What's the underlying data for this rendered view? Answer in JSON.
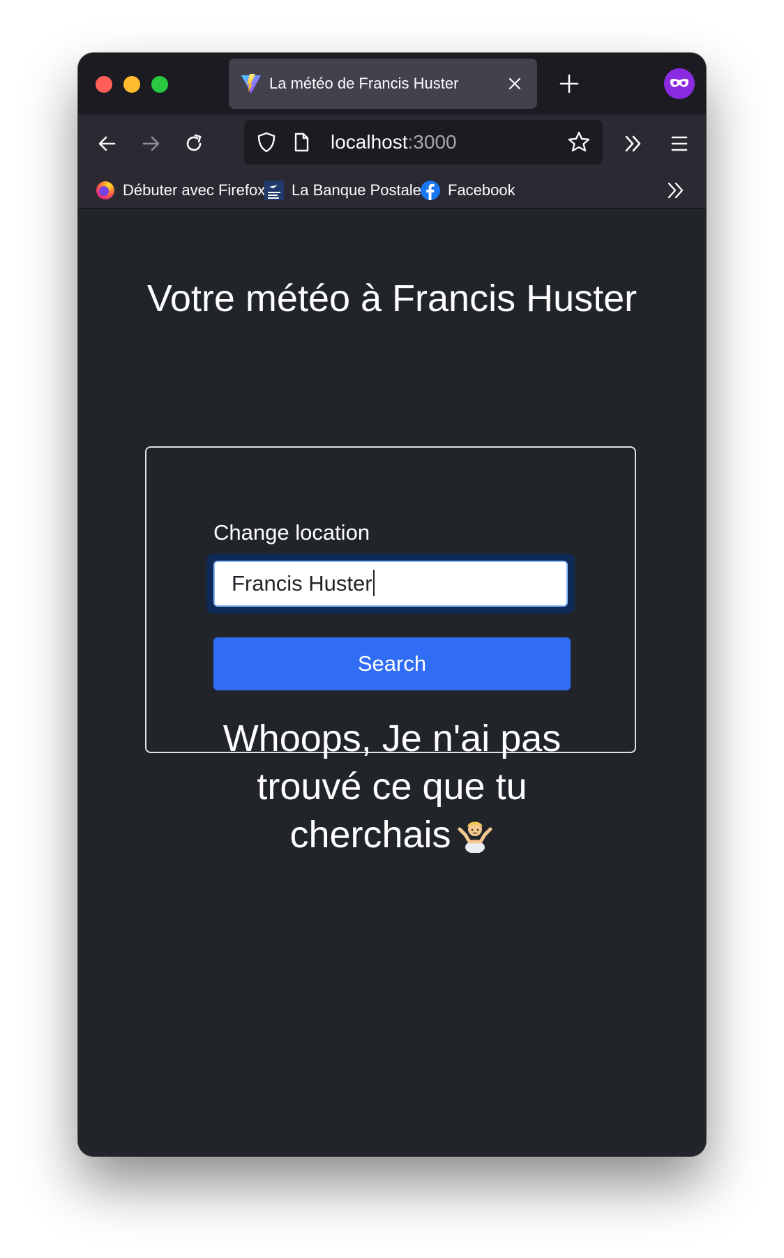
{
  "browser": {
    "tab": {
      "title": "La météo de Francis Huster"
    },
    "url": {
      "host": "localhost",
      "port": ":3000"
    },
    "bookmarks": [
      {
        "label": "Débuter avec Firefox",
        "icon": "firefox-icon"
      },
      {
        "label": "La Banque Postale",
        "icon": "la-banque-postale-icon"
      },
      {
        "label": "Facebook",
        "icon": "facebook-icon"
      }
    ]
  },
  "page": {
    "title": "Votre météo à Francis Huster",
    "form": {
      "label": "Change location",
      "input_value": "Francis Huster",
      "button_label": "Search"
    },
    "error_message": "Whoops, Je n'ai pas trouvé ce que tu cherchais"
  },
  "colors": {
    "page_background": "#212529",
    "button": "#316cf4",
    "input_focus_border": "#86b7fe"
  }
}
